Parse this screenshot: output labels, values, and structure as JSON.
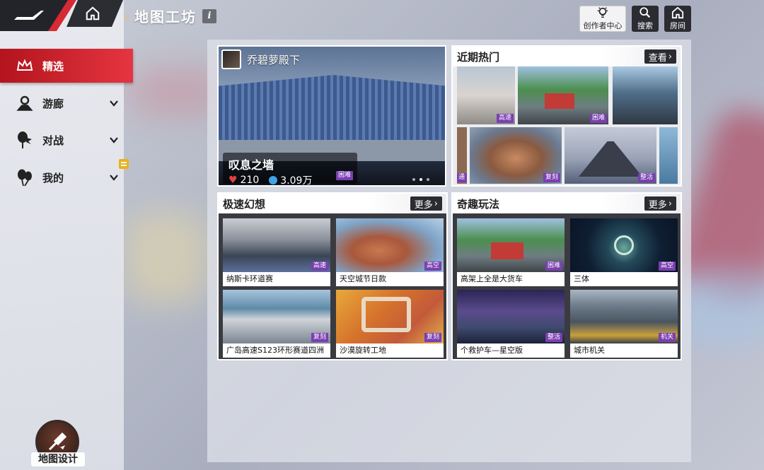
{
  "header": {
    "title": "地图工坊",
    "info_icon": "i",
    "buttons": [
      {
        "label": "创作者中心",
        "icon": "lightbulb-icon"
      },
      {
        "label": "搜索",
        "icon": "search-icon"
      },
      {
        "label": "房间",
        "icon": "home-icon"
      }
    ]
  },
  "sidebar": {
    "items": [
      {
        "label": "精选",
        "icon": "crown-icon",
        "active": true
      },
      {
        "label": "游廊",
        "icon": "map-pin-icon",
        "active": false
      },
      {
        "label": "对战",
        "icon": "balloon-battle-icon",
        "active": false
      },
      {
        "label": "我的",
        "icon": "balloons-icon",
        "active": false
      }
    ],
    "map_design_label": "地图设计"
  },
  "featured": {
    "author": "乔碧萝殿下",
    "name": "叹息之墙",
    "likes": "210",
    "plays": "3.09万",
    "tag": "困难"
  },
  "recent": {
    "title": "近期热门",
    "action": "查看",
    "tags": [
      "高速",
      "困难",
      "",
      "通",
      "复刻",
      "整活"
    ]
  },
  "speed": {
    "title": "极速幻想",
    "action": "更多",
    "items": [
      {
        "name": "纳斯卡环道赛",
        "tag": "高速"
      },
      {
        "name": "天空城节日款",
        "tag": "高空"
      },
      {
        "name": "广岛高速S123环形赛道四洲",
        "tag": "复刻"
      },
      {
        "name": "沙漠旋转工地",
        "tag": "复刻"
      }
    ]
  },
  "fun": {
    "title": "奇趣玩法",
    "action": "更多",
    "items": [
      {
        "name": "高架上全是大货车",
        "tag": "困难"
      },
      {
        "name": "三体",
        "tag": "高空"
      },
      {
        "name": "个救护车—星空版",
        "tag": "整活"
      },
      {
        "name": "城市机关",
        "tag": "机关"
      }
    ]
  }
}
